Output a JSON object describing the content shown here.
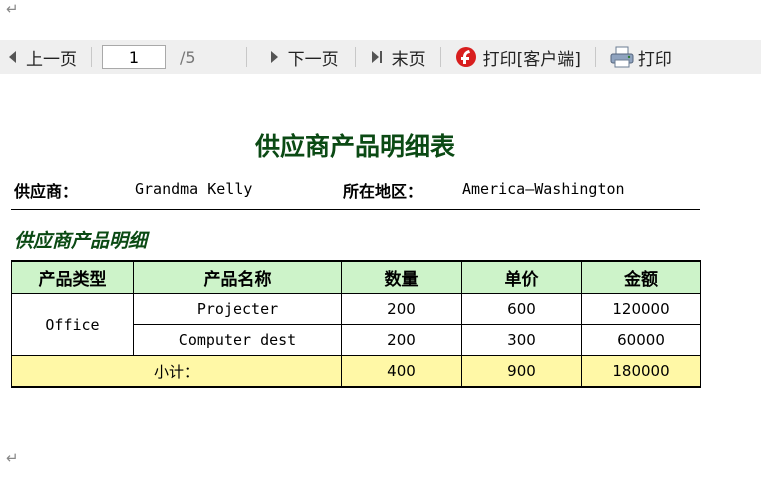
{
  "return_symbol": "↵",
  "toolbar": {
    "prev_label": "上一页",
    "page_value": "1",
    "page_total": "/5",
    "next_label": "下一页",
    "last_label": "末页",
    "print_client_label": "打印[客户端]",
    "print_label": "打印"
  },
  "report": {
    "title": "供应商产品明细表",
    "supplier_label": "供应商：",
    "supplier_value": "Grandma Kelly",
    "region_label": "所在地区：",
    "region_value": "America—Washington",
    "section_title": "供应商产品明细"
  },
  "table": {
    "headers": [
      "产品类型",
      "产品名称",
      "数量",
      "单价",
      "金额"
    ],
    "group_category": "Office",
    "rows": [
      {
        "name": "Projecter",
        "qty": "200",
        "price": "600",
        "amount": "120000"
      },
      {
        "name": "Computer dest",
        "qty": "200",
        "price": "300",
        "amount": "60000"
      }
    ],
    "subtotal": {
      "label": "小计：",
      "qty": "400",
      "price": "900",
      "amount": "180000"
    }
  },
  "colors": {
    "title": "#0b4a14",
    "header_bg": "#cdf3c9",
    "subtotal_bg": "#fff8a6",
    "toolbar_bg": "#efefef"
  },
  "icons": [
    "prev-arrow-icon",
    "next-arrow-icon",
    "last-page-icon",
    "flash-print-icon",
    "printer-icon"
  ]
}
